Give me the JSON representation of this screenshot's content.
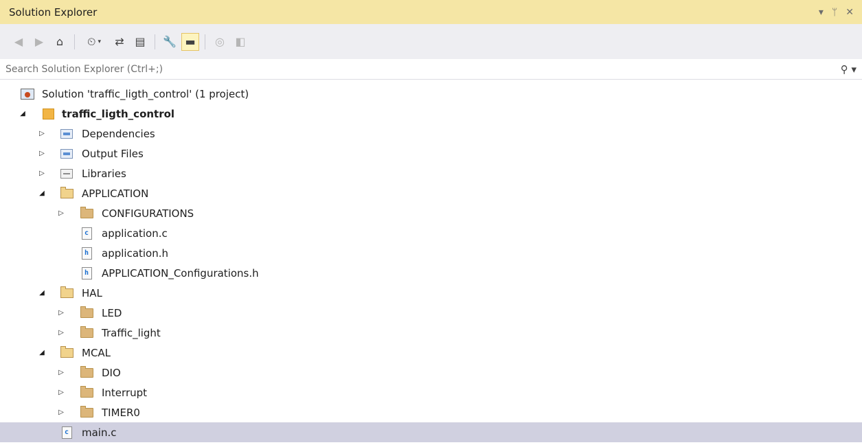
{
  "window": {
    "title": "Solution Explorer",
    "controls": {
      "dropdown": "▾",
      "pin": "ᛘ",
      "close": "✕"
    }
  },
  "toolbar": {
    "buttons": [
      {
        "name": "back-button",
        "icon": "back-icon",
        "glyph": "◀"
      },
      {
        "name": "forward-button",
        "icon": "forward-icon",
        "glyph": "▶"
      },
      {
        "name": "home-button",
        "icon": "home-icon",
        "glyph": "⌂"
      },
      {
        "name": "pending-changes-filter-button",
        "icon": "history-icon",
        "glyph": "⏲"
      },
      {
        "name": "sync-button",
        "icon": "sync-icon",
        "glyph": "⇄"
      },
      {
        "name": "show-all-files-button",
        "icon": "show-all-files-icon",
        "glyph": "▤"
      },
      {
        "name": "properties-button",
        "icon": "wrench-icon",
        "glyph": "🔧"
      },
      {
        "name": "preview-button",
        "icon": "preview-icon",
        "glyph": "▬"
      },
      {
        "name": "view-code-button",
        "icon": "code-icon",
        "glyph": "◎"
      },
      {
        "name": "view-designer-button",
        "icon": "designer-icon",
        "glyph": "◧"
      }
    ]
  },
  "search": {
    "placeholder": "Search Solution Explorer (Ctrl+;)",
    "value": "",
    "icon": "search-icon"
  },
  "tree": {
    "solution": "Solution 'traffic_ligth_control' (1 project)",
    "project": "traffic_ligth_control",
    "items": {
      "dependencies": "Dependencies",
      "output_files": "Output Files",
      "libraries": "Libraries",
      "application": "APPLICATION",
      "configurations": "CONFIGURATIONS",
      "application_c": "application.c",
      "application_h": "application.h",
      "application_config_h": "APPLICATION_Configurations.h",
      "hal": "HAL",
      "led": "LED",
      "traffic_light": "Traffic_light",
      "mcal": "MCAL",
      "dio": "DIO",
      "interrupt": "Interrupt",
      "timer0": "TIMER0",
      "main_c": "main.c"
    },
    "file_glyphs": {
      "c": "c",
      "h": "h"
    },
    "selected": "main.c"
  },
  "colors": {
    "title_bg": "#f5e6a5",
    "toolbar_bg": "#eeeef2",
    "selected_row": "#d0d0e0"
  }
}
